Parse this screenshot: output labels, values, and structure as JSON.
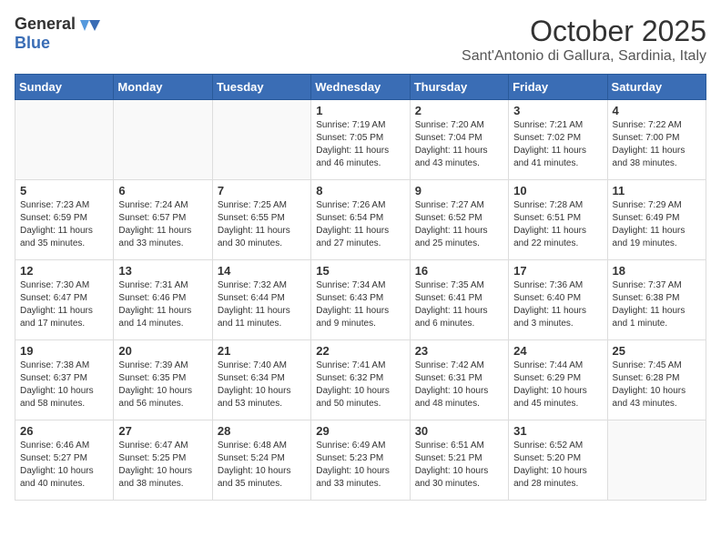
{
  "header": {
    "logo_general": "General",
    "logo_blue": "Blue",
    "title": "October 2025",
    "subtitle": "Sant'Antonio di Gallura, Sardinia, Italy"
  },
  "days_of_week": [
    "Sunday",
    "Monday",
    "Tuesday",
    "Wednesday",
    "Thursday",
    "Friday",
    "Saturday"
  ],
  "weeks": [
    [
      {
        "day": "",
        "info": ""
      },
      {
        "day": "",
        "info": ""
      },
      {
        "day": "",
        "info": ""
      },
      {
        "day": "1",
        "info": "Sunrise: 7:19 AM\nSunset: 7:05 PM\nDaylight: 11 hours and 46 minutes."
      },
      {
        "day": "2",
        "info": "Sunrise: 7:20 AM\nSunset: 7:04 PM\nDaylight: 11 hours and 43 minutes."
      },
      {
        "day": "3",
        "info": "Sunrise: 7:21 AM\nSunset: 7:02 PM\nDaylight: 11 hours and 41 minutes."
      },
      {
        "day": "4",
        "info": "Sunrise: 7:22 AM\nSunset: 7:00 PM\nDaylight: 11 hours and 38 minutes."
      }
    ],
    [
      {
        "day": "5",
        "info": "Sunrise: 7:23 AM\nSunset: 6:59 PM\nDaylight: 11 hours and 35 minutes."
      },
      {
        "day": "6",
        "info": "Sunrise: 7:24 AM\nSunset: 6:57 PM\nDaylight: 11 hours and 33 minutes."
      },
      {
        "day": "7",
        "info": "Sunrise: 7:25 AM\nSunset: 6:55 PM\nDaylight: 11 hours and 30 minutes."
      },
      {
        "day": "8",
        "info": "Sunrise: 7:26 AM\nSunset: 6:54 PM\nDaylight: 11 hours and 27 minutes."
      },
      {
        "day": "9",
        "info": "Sunrise: 7:27 AM\nSunset: 6:52 PM\nDaylight: 11 hours and 25 minutes."
      },
      {
        "day": "10",
        "info": "Sunrise: 7:28 AM\nSunset: 6:51 PM\nDaylight: 11 hours and 22 minutes."
      },
      {
        "day": "11",
        "info": "Sunrise: 7:29 AM\nSunset: 6:49 PM\nDaylight: 11 hours and 19 minutes."
      }
    ],
    [
      {
        "day": "12",
        "info": "Sunrise: 7:30 AM\nSunset: 6:47 PM\nDaylight: 11 hours and 17 minutes."
      },
      {
        "day": "13",
        "info": "Sunrise: 7:31 AM\nSunset: 6:46 PM\nDaylight: 11 hours and 14 minutes."
      },
      {
        "day": "14",
        "info": "Sunrise: 7:32 AM\nSunset: 6:44 PM\nDaylight: 11 hours and 11 minutes."
      },
      {
        "day": "15",
        "info": "Sunrise: 7:34 AM\nSunset: 6:43 PM\nDaylight: 11 hours and 9 minutes."
      },
      {
        "day": "16",
        "info": "Sunrise: 7:35 AM\nSunset: 6:41 PM\nDaylight: 11 hours and 6 minutes."
      },
      {
        "day": "17",
        "info": "Sunrise: 7:36 AM\nSunset: 6:40 PM\nDaylight: 11 hours and 3 minutes."
      },
      {
        "day": "18",
        "info": "Sunrise: 7:37 AM\nSunset: 6:38 PM\nDaylight: 11 hours and 1 minute."
      }
    ],
    [
      {
        "day": "19",
        "info": "Sunrise: 7:38 AM\nSunset: 6:37 PM\nDaylight: 10 hours and 58 minutes."
      },
      {
        "day": "20",
        "info": "Sunrise: 7:39 AM\nSunset: 6:35 PM\nDaylight: 10 hours and 56 minutes."
      },
      {
        "day": "21",
        "info": "Sunrise: 7:40 AM\nSunset: 6:34 PM\nDaylight: 10 hours and 53 minutes."
      },
      {
        "day": "22",
        "info": "Sunrise: 7:41 AM\nSunset: 6:32 PM\nDaylight: 10 hours and 50 minutes."
      },
      {
        "day": "23",
        "info": "Sunrise: 7:42 AM\nSunset: 6:31 PM\nDaylight: 10 hours and 48 minutes."
      },
      {
        "day": "24",
        "info": "Sunrise: 7:44 AM\nSunset: 6:29 PM\nDaylight: 10 hours and 45 minutes."
      },
      {
        "day": "25",
        "info": "Sunrise: 7:45 AM\nSunset: 6:28 PM\nDaylight: 10 hours and 43 minutes."
      }
    ],
    [
      {
        "day": "26",
        "info": "Sunrise: 6:46 AM\nSunset: 5:27 PM\nDaylight: 10 hours and 40 minutes."
      },
      {
        "day": "27",
        "info": "Sunrise: 6:47 AM\nSunset: 5:25 PM\nDaylight: 10 hours and 38 minutes."
      },
      {
        "day": "28",
        "info": "Sunrise: 6:48 AM\nSunset: 5:24 PM\nDaylight: 10 hours and 35 minutes."
      },
      {
        "day": "29",
        "info": "Sunrise: 6:49 AM\nSunset: 5:23 PM\nDaylight: 10 hours and 33 minutes."
      },
      {
        "day": "30",
        "info": "Sunrise: 6:51 AM\nSunset: 5:21 PM\nDaylight: 10 hours and 30 minutes."
      },
      {
        "day": "31",
        "info": "Sunrise: 6:52 AM\nSunset: 5:20 PM\nDaylight: 10 hours and 28 minutes."
      },
      {
        "day": "",
        "info": ""
      }
    ]
  ]
}
